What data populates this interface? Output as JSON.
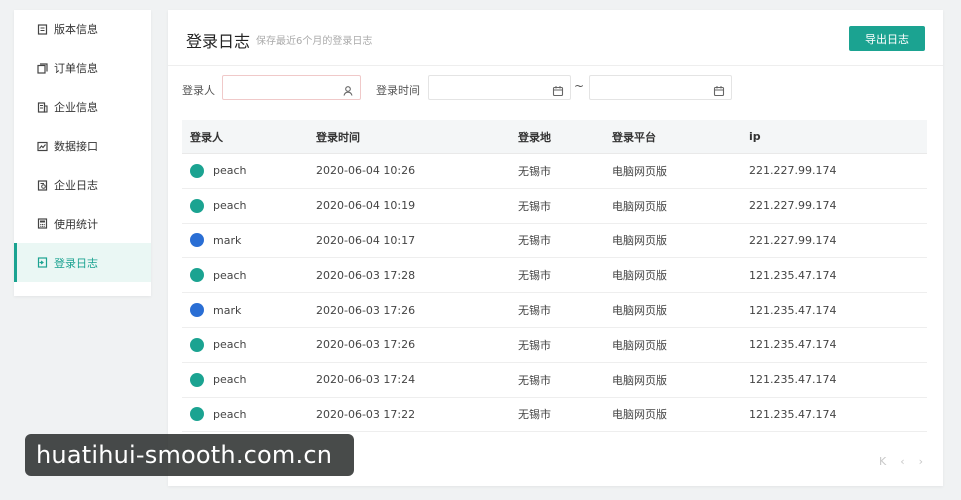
{
  "sidebar": {
    "items": [
      {
        "label": "版本信息",
        "icon": "document-icon",
        "active": false
      },
      {
        "label": "订单信息",
        "icon": "copy-icon",
        "active": false
      },
      {
        "label": "企业信息",
        "icon": "building-icon",
        "active": false
      },
      {
        "label": "数据接口",
        "icon": "chart-icon",
        "active": false
      },
      {
        "label": "企业日志",
        "icon": "log-icon",
        "active": false
      },
      {
        "label": "使用统计",
        "icon": "calculator-icon",
        "active": false
      },
      {
        "label": "登录日志",
        "icon": "login-icon",
        "active": true
      }
    ]
  },
  "header": {
    "title": "登录日志",
    "subtitle": "保存最近6个月的登录日志",
    "export_label": "导出日志"
  },
  "filters": {
    "user_label": "登录人",
    "user_value": "",
    "time_label": "登录时间",
    "start_value": "",
    "end_value": "",
    "separator": "~"
  },
  "table": {
    "columns": [
      "登录人",
      "登录时间",
      "登录地",
      "登录平台",
      "ip"
    ],
    "rows": [
      {
        "user": "peach",
        "avatar": "green",
        "time": "2020-06-04 10:26",
        "location": "无锡市",
        "platform": "电脑网页版",
        "ip": "221.227.99.174"
      },
      {
        "user": "peach",
        "avatar": "green",
        "time": "2020-06-04 10:19",
        "location": "无锡市",
        "platform": "电脑网页版",
        "ip": "221.227.99.174"
      },
      {
        "user": "mark",
        "avatar": "blue",
        "time": "2020-06-04 10:17",
        "location": "无锡市",
        "platform": "电脑网页版",
        "ip": "221.227.99.174"
      },
      {
        "user": "peach",
        "avatar": "green",
        "time": "2020-06-03 17:28",
        "location": "无锡市",
        "platform": "电脑网页版",
        "ip": "121.235.47.174"
      },
      {
        "user": "mark",
        "avatar": "blue",
        "time": "2020-06-03 17:26",
        "location": "无锡市",
        "platform": "电脑网页版",
        "ip": "121.235.47.174"
      },
      {
        "user": "peach",
        "avatar": "green",
        "time": "2020-06-03 17:26",
        "location": "无锡市",
        "platform": "电脑网页版",
        "ip": "121.235.47.174"
      },
      {
        "user": "peach",
        "avatar": "green",
        "time": "2020-06-03 17:24",
        "location": "无锡市",
        "platform": "电脑网页版",
        "ip": "121.235.47.174"
      },
      {
        "user": "peach",
        "avatar": "green",
        "time": "2020-06-03 17:22",
        "location": "无锡市",
        "platform": "电脑网页版",
        "ip": "121.235.47.174"
      }
    ]
  },
  "pagination": {
    "first": "K",
    "prev": "‹",
    "next": "›"
  },
  "watermark": "huatihui-smooth.com.cn",
  "colors": {
    "accent": "#1ba391",
    "avatar_green": "#1ba391",
    "avatar_blue": "#2a6ed4"
  }
}
